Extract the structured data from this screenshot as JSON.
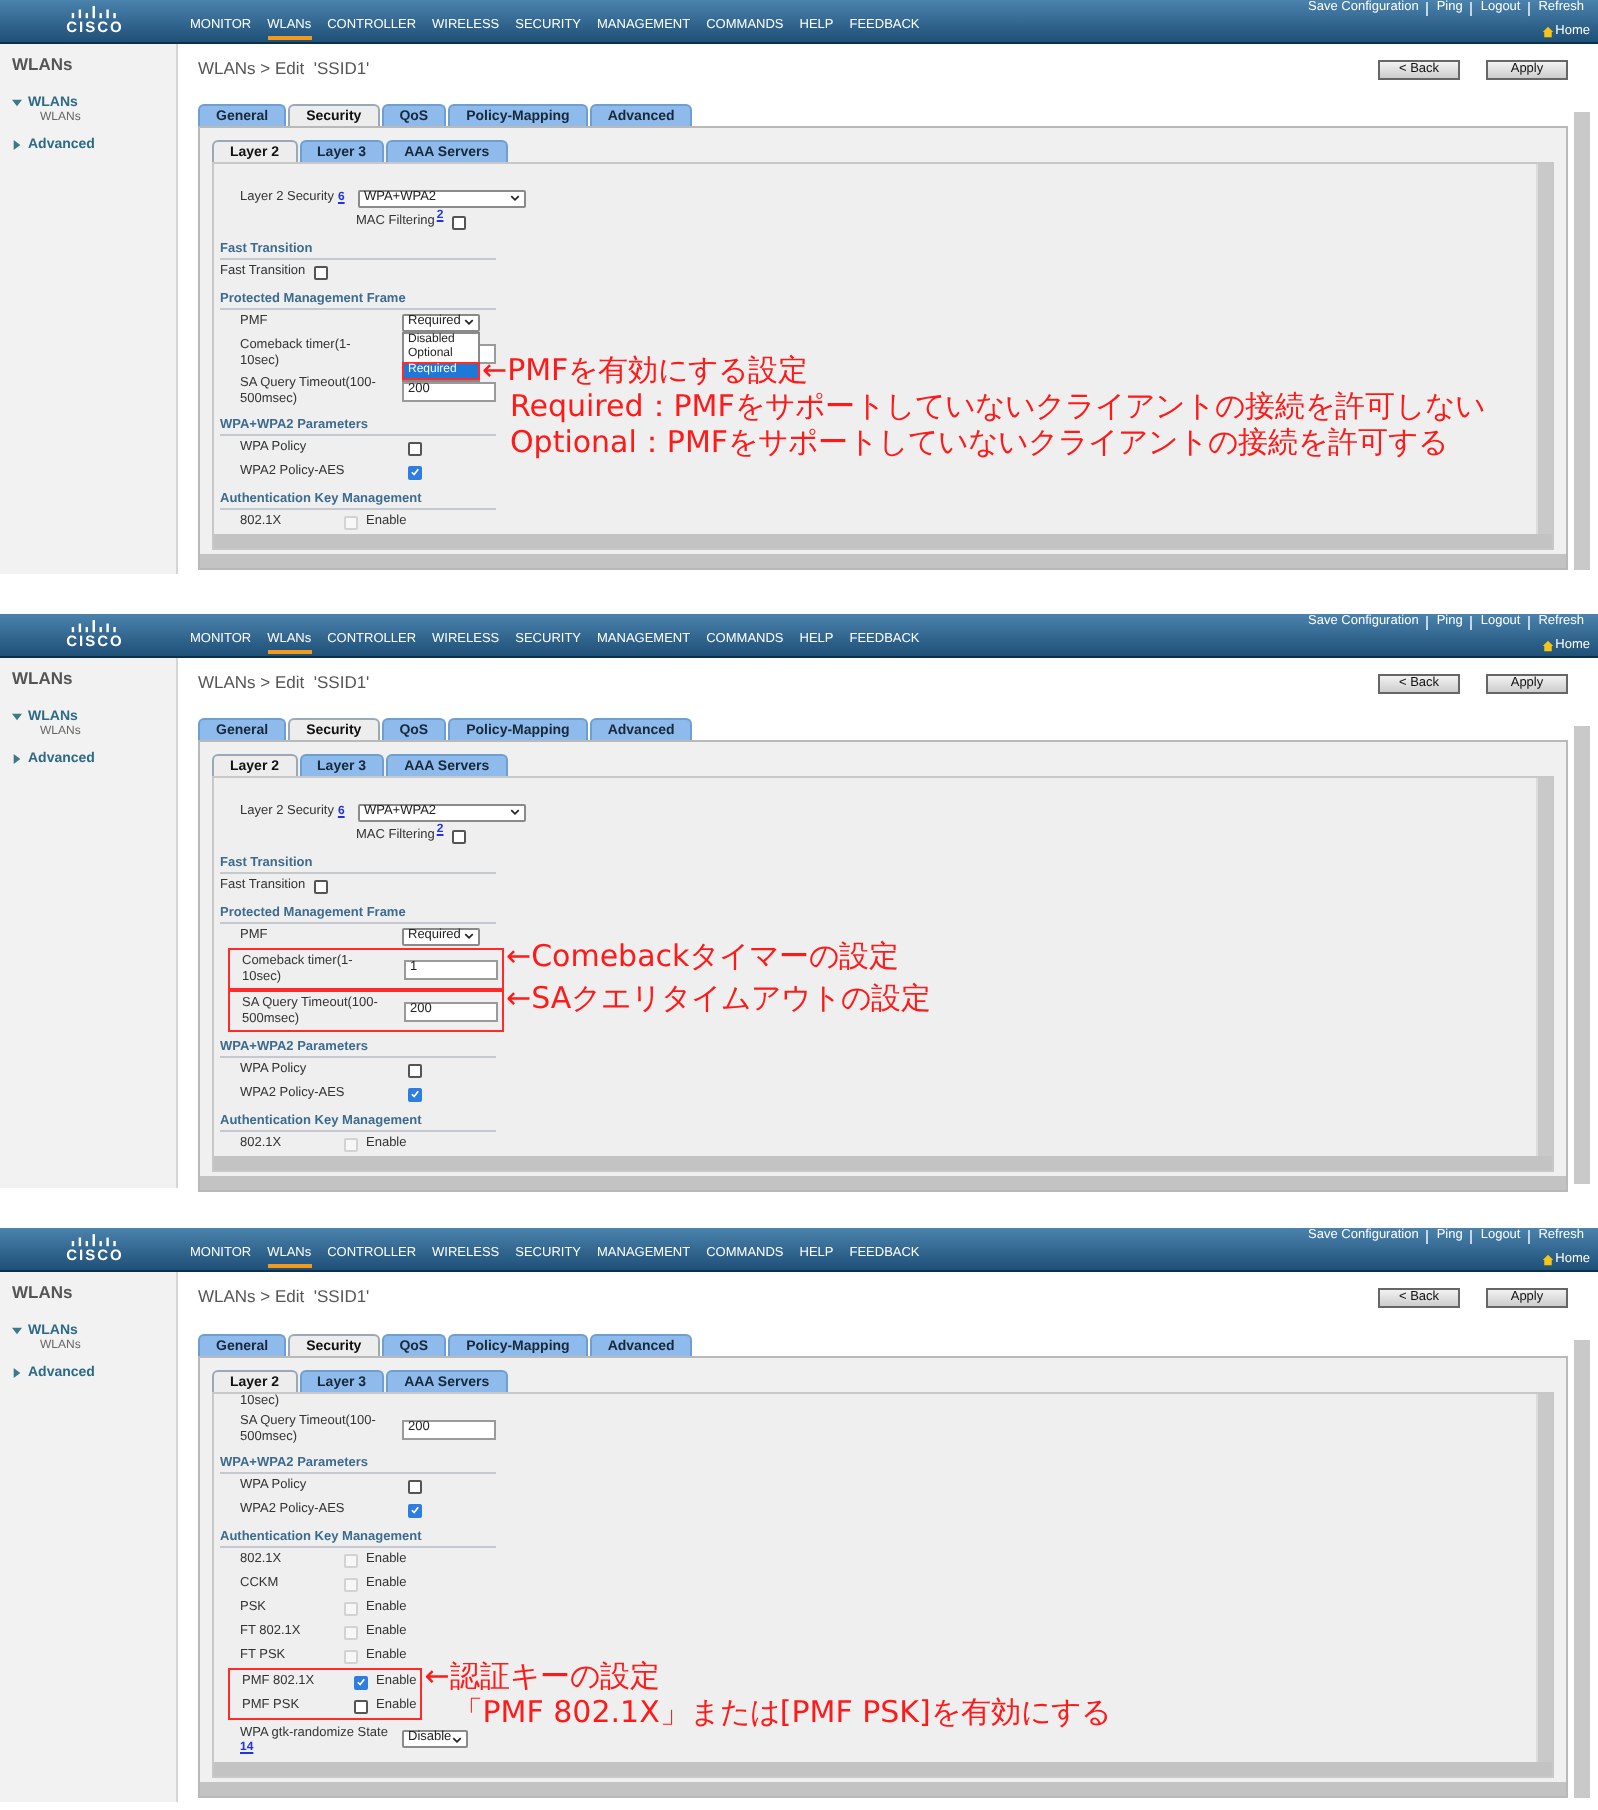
{
  "panels": [
    {
      "header": {
        "logo": "CISCO",
        "top_links": [
          "Save Configuration",
          "Ping",
          "Logout",
          "Refresh"
        ],
        "nav": [
          {
            "label": "MONITOR",
            "selected": false
          },
          {
            "label": "WLANs",
            "selected": true
          },
          {
            "label": "CONTROLLER",
            "selected": false
          },
          {
            "label": "WIRELESS",
            "selected": false
          },
          {
            "label": "SECURITY",
            "selected": false
          },
          {
            "label": "MANAGEMENT",
            "selected": false
          },
          {
            "label": "COMMANDS",
            "selected": false
          },
          {
            "label": "HELP",
            "selected": false
          },
          {
            "label": "FEEDBACK",
            "selected": false
          }
        ],
        "home": "Home"
      },
      "sidebar": {
        "title": "WLANs",
        "items": [
          {
            "label": "WLANs",
            "expanded": true,
            "children": [
              {
                "label": "WLANs"
              }
            ]
          },
          {
            "label": "Advanced",
            "expanded": false
          }
        ]
      },
      "breadcrumb": "WLANs > Edit  'SSID1'",
      "buttons": [
        "< Back",
        "Apply"
      ],
      "tabs": [
        {
          "label": "General",
          "selected": false
        },
        {
          "label": "Security",
          "selected": true
        },
        {
          "label": "QoS",
          "selected": false
        },
        {
          "label": "Policy-Mapping",
          "selected": false
        },
        {
          "label": "Advanced",
          "selected": false
        }
      ],
      "subtabs": [
        {
          "label": "Layer 2",
          "selected": true
        },
        {
          "label": "Layer 3",
          "selected": false
        },
        {
          "label": "AAA Servers",
          "selected": false
        }
      ],
      "rows": [
        {
          "kind": "select",
          "label": "Layer 2 Security",
          "help": "6",
          "value": "WPA+WPA2"
        },
        {
          "kind": "mac_filter",
          "label": "MAC Filtering",
          "help": "2",
          "checked": false
        },
        {
          "kind": "heading",
          "label": "Fast Transition"
        },
        {
          "kind": "flag",
          "label": "Fast Transition",
          "checked": false
        },
        {
          "kind": "heading",
          "label": "Protected Management Frame"
        },
        {
          "kind": "pmf",
          "label": "PMF",
          "value": "Required",
          "options": [
            {
              "label": "Disabled",
              "selected": false
            },
            {
              "label": "Optional",
              "selected": false
            },
            {
              "label": "Required",
              "selected": true,
              "boxed": true,
              "note": [
                "←PMFを有効にする設定",
                "Required：PMFをサポートしていないクライアントの接続を許可しない",
                "Optional：PMFをサポートしていないクライアントの接続を許可する"
              ]
            }
          ]
        },
        {
          "kind": "input",
          "label": "Comeback timer(1-10sec)"
        },
        {
          "kind": "input",
          "label": "SA Query Timeout(100-500msec)",
          "value": "200"
        },
        {
          "kind": "heading",
          "label": "WPA+WPA2 Parameters"
        },
        {
          "kind": "check",
          "label": "WPA Policy",
          "checked": false
        },
        {
          "kind": "check",
          "label": "WPA2 Policy-AES",
          "checked": true
        },
        {
          "kind": "heading",
          "label": "Authentication Key Management"
        },
        {
          "kind": "enable",
          "label": "802.1X",
          "enable_label": "Enable",
          "checked": false,
          "disabled": true
        }
      ]
    },
    {
      "header": {
        "logo": "CISCO",
        "top_links": [
          "Save Configuration",
          "Ping",
          "Logout",
          "Refresh"
        ],
        "nav": [
          {
            "label": "MONITOR",
            "selected": false
          },
          {
            "label": "WLANs",
            "selected": true
          },
          {
            "label": "CONTROLLER",
            "selected": false
          },
          {
            "label": "WIRELESS",
            "selected": false
          },
          {
            "label": "SECURITY",
            "selected": false
          },
          {
            "label": "MANAGEMENT",
            "selected": false
          },
          {
            "label": "COMMANDS",
            "selected": false
          },
          {
            "label": "HELP",
            "selected": false
          },
          {
            "label": "FEEDBACK",
            "selected": false
          }
        ],
        "home": "Home"
      },
      "sidebar": {
        "title": "WLANs",
        "items": [
          {
            "label": "WLANs",
            "expanded": true,
            "children": [
              {
                "label": "WLANs"
              }
            ]
          },
          {
            "label": "Advanced",
            "expanded": false
          }
        ]
      },
      "breadcrumb": "WLANs > Edit  'SSID1'",
      "buttons": [
        "< Back",
        "Apply"
      ],
      "tabs": [
        {
          "label": "General",
          "selected": false
        },
        {
          "label": "Security",
          "selected": true
        },
        {
          "label": "QoS",
          "selected": false
        },
        {
          "label": "Policy-Mapping",
          "selected": false
        },
        {
          "label": "Advanced",
          "selected": false
        }
      ],
      "subtabs": [
        {
          "label": "Layer 2",
          "selected": true
        },
        {
          "label": "Layer 3",
          "selected": false
        },
        {
          "label": "AAA Servers",
          "selected": false
        }
      ],
      "rows": [
        {
          "kind": "select",
          "label": "Layer 2 Security",
          "help": "6",
          "value": "WPA+WPA2"
        },
        {
          "kind": "mac_filter",
          "label": "MAC Filtering",
          "help": "2",
          "checked": false
        },
        {
          "kind": "heading",
          "label": "Fast Transition"
        },
        {
          "kind": "flag",
          "label": "Fast Transition",
          "checked": false
        },
        {
          "kind": "heading",
          "label": "Protected Management Frame"
        },
        {
          "kind": "pmf",
          "label": "PMF",
          "value": "Required"
        },
        {
          "kind": "input",
          "label": "Comeback timer(1-10sec)",
          "value": "1",
          "boxed": true,
          "note": [
            "←Comebackタイマーの設定"
          ]
        },
        {
          "kind": "input",
          "label": "SA Query Timeout(100-500msec)",
          "value": "200",
          "boxed": true,
          "note": [
            "←SAクエリタイムアウトの設定"
          ]
        },
        {
          "kind": "heading",
          "label": "WPA+WPA2 Parameters"
        },
        {
          "kind": "check",
          "label": "WPA Policy",
          "checked": false
        },
        {
          "kind": "check",
          "label": "WPA2 Policy-AES",
          "checked": true
        },
        {
          "kind": "heading",
          "label": "Authentication Key Management"
        },
        {
          "kind": "enable",
          "label": "802.1X",
          "enable_label": "Enable",
          "checked": false,
          "disabled": true
        }
      ]
    },
    {
      "header": {
        "logo": "CISCO",
        "top_links": [
          "Save Configuration",
          "Ping",
          "Logout",
          "Refresh"
        ],
        "nav": [
          {
            "label": "MONITOR",
            "selected": false
          },
          {
            "label": "WLANs",
            "selected": true
          },
          {
            "label": "CONTROLLER",
            "selected": false
          },
          {
            "label": "WIRELESS",
            "selected": false
          },
          {
            "label": "SECURITY",
            "selected": false
          },
          {
            "label": "MANAGEMENT",
            "selected": false
          },
          {
            "label": "COMMANDS",
            "selected": false
          },
          {
            "label": "HELP",
            "selected": false
          },
          {
            "label": "FEEDBACK",
            "selected": false
          }
        ],
        "home": "Home"
      },
      "sidebar": {
        "title": "WLANs",
        "items": [
          {
            "label": "WLANs",
            "expanded": true,
            "children": [
              {
                "label": "WLANs"
              }
            ]
          },
          {
            "label": "Advanced",
            "expanded": false
          }
        ]
      },
      "breadcrumb": "WLANs > Edit  'SSID1'",
      "buttons": [
        "< Back",
        "Apply"
      ],
      "tabs": [
        {
          "label": "General",
          "selected": false
        },
        {
          "label": "Security",
          "selected": true
        },
        {
          "label": "QoS",
          "selected": false
        },
        {
          "label": "Policy-Mapping",
          "selected": false
        },
        {
          "label": "Advanced",
          "selected": false
        }
      ],
      "subtabs": [
        {
          "label": "Layer 2",
          "selected": true
        },
        {
          "label": "Layer 3",
          "selected": false
        },
        {
          "label": "AAA Servers",
          "selected": false
        }
      ],
      "rows": [
        {
          "kind": "fragment",
          "label": "10sec)"
        },
        {
          "kind": "input",
          "label": "SA Query Timeout(100-500msec)",
          "value": "200"
        },
        {
          "kind": "heading",
          "label": "WPA+WPA2 Parameters"
        },
        {
          "kind": "check",
          "label": "WPA Policy",
          "checked": false
        },
        {
          "kind": "check",
          "label": "WPA2 Policy-AES",
          "checked": true
        },
        {
          "kind": "heading",
          "label": "Authentication Key Management"
        },
        {
          "kind": "enable",
          "label": "802.1X",
          "enable_label": "Enable",
          "checked": false,
          "disabled": true
        },
        {
          "kind": "enable",
          "label": "CCKM",
          "enable_label": "Enable",
          "checked": false,
          "disabled": true
        },
        {
          "kind": "enable",
          "label": "PSK",
          "enable_label": "Enable",
          "checked": false,
          "disabled": true
        },
        {
          "kind": "enable",
          "label": "FT 802.1X",
          "enable_label": "Enable",
          "checked": false,
          "disabled": true
        },
        {
          "kind": "enable",
          "label": "FT PSK",
          "enable_label": "Enable",
          "checked": false,
          "disabled": true
        },
        {
          "kind": "enable",
          "label": "PMF 802.1X",
          "enable_label": "Enable",
          "checked": true,
          "disabled": false,
          "boxed": true,
          "note": [
            "←認証キーの設定",
            "「PMF 802.1X」または[PMF PSK]を有効にする"
          ]
        },
        {
          "kind": "enable",
          "label": "PMF PSK",
          "enable_label": "Enable",
          "checked": false,
          "disabled": false,
          "boxed": true
        },
        {
          "kind": "gtk",
          "label": "WPA gtk-randomize State",
          "help": "14",
          "value": "Disable"
        }
      ]
    }
  ]
}
